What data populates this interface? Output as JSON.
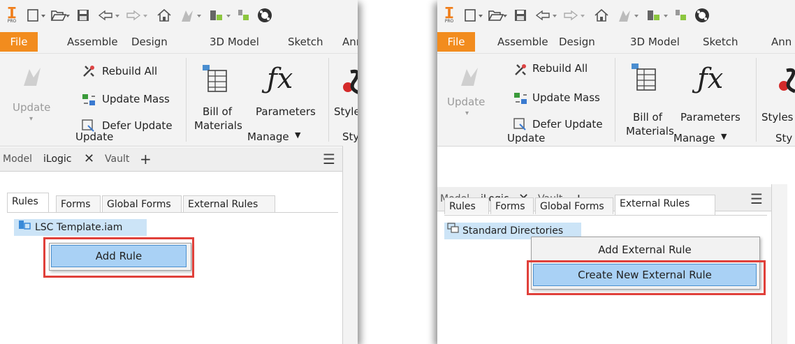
{
  "toolbar": {
    "icons": [
      "inventor-pro-icon",
      "new-icon",
      "open-icon",
      "save-icon",
      "undo-icon",
      "redo-icon",
      "home-icon",
      "update-icon",
      "select-icon",
      "appearance-icon",
      "material-icon"
    ],
    "pro_label": "PRO"
  },
  "menu": {
    "file": "File",
    "items": [
      "Assemble",
      "Design",
      "3D Model",
      "Sketch",
      "Ann"
    ]
  },
  "ribbon": {
    "update_button": "Update",
    "rebuild_all": "Rebuild All",
    "update_mass": "Update Mass",
    "defer_update": "Defer Update",
    "update_group": "Update",
    "bom_line1": "Bill of",
    "bom_line2": "Materials",
    "parameters": "Parameters",
    "styles": "Styles",
    "manage_group": "Manage",
    "styles_group_left": "Styl",
    "styles_group_right": "Sty"
  },
  "browser": {
    "tab_model": "Model",
    "tab_ilogic": "iLogic",
    "tab_vault": "Vault",
    "subtabs": [
      "Rules",
      "Forms",
      "Global Forms",
      "External Rules"
    ]
  },
  "left_panel": {
    "tree_item": "LSC Template.iam",
    "context_menu": [
      "Add Rule"
    ]
  },
  "right_panel": {
    "tree_item": "Standard Directories",
    "context_menu": [
      "Add External Rule",
      "Create New External Rule"
    ]
  },
  "colors": {
    "file_tab": "#f28c1e",
    "highlight": "#a9d1f5",
    "callout": "#e0403a",
    "inventor_orange": "#f07d18"
  }
}
